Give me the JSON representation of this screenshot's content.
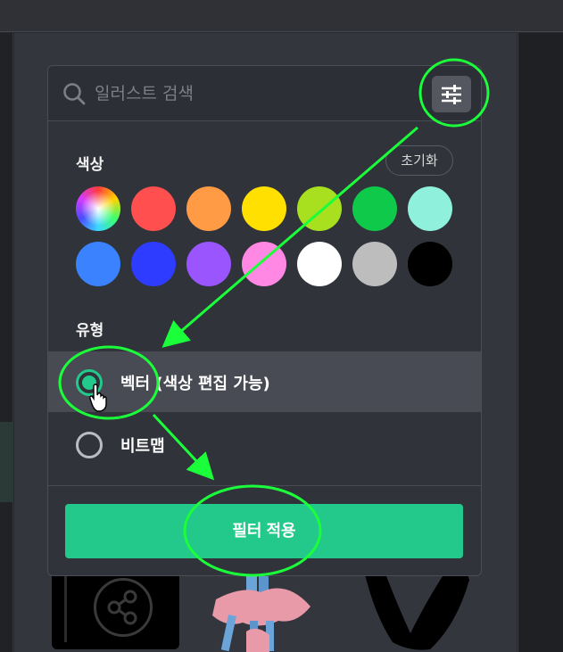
{
  "search": {
    "placeholder": "일러스트 검색",
    "value": ""
  },
  "filter_button": {
    "icon": "sliders-icon"
  },
  "color_section": {
    "title": "색상",
    "reset_label": "초기화",
    "swatches": [
      {
        "name": "multicolor",
        "color": "conic-gradient"
      },
      {
        "name": "red",
        "color": "#ff4f4f"
      },
      {
        "name": "orange",
        "color": "#ff9a45"
      },
      {
        "name": "yellow",
        "color": "#ffe000"
      },
      {
        "name": "lime",
        "color": "#a8e020"
      },
      {
        "name": "green",
        "color": "#0fc94a"
      },
      {
        "name": "mint",
        "color": "#8ff0dc"
      },
      {
        "name": "blue",
        "color": "#3b82ff"
      },
      {
        "name": "indigo",
        "color": "#2d3cff"
      },
      {
        "name": "purple",
        "color": "#9a55ff"
      },
      {
        "name": "pink",
        "color": "#ff88e4"
      },
      {
        "name": "white",
        "color": "#ffffff"
      },
      {
        "name": "gray",
        "color": "#bdbdbd"
      },
      {
        "name": "black",
        "color": "#000000"
      }
    ]
  },
  "type_section": {
    "title": "유형",
    "options": [
      {
        "label": "벡터 (색상 편집 가능)",
        "selected": true
      },
      {
        "label": "비트맵",
        "selected": false
      }
    ]
  },
  "apply_label": "필터 적용",
  "colors": {
    "accent": "#22c98a",
    "annotation": "#1aff3a",
    "panel_bg": "#30333a"
  }
}
